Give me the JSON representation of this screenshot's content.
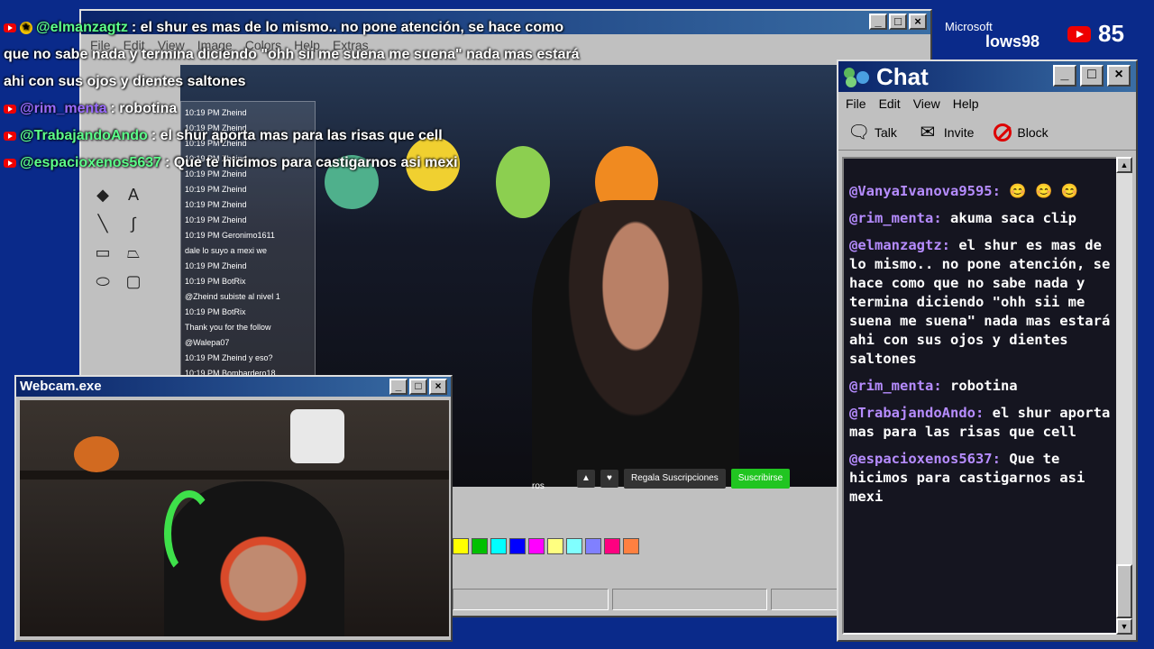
{
  "overlay_chat": {
    "lines": [
      {
        "user": "@elmanzagtz",
        "user_color": "#5cff8a",
        "text": ": el shur es mas de lo mismo.. no pone atención, se hace como"
      },
      {
        "text": "que no sabe nada y termina diciendo \"ohh sii me suena me suena\" nada mas estará"
      },
      {
        "text": "ahi con sus ojos y dientes saltones"
      },
      {
        "user": "@rim_menta",
        "user_color": "#9b6bff",
        "text": ": robotina"
      },
      {
        "user": "@TrabajandoAndo",
        "user_color": "#5cff8a",
        "text": ": el shur aporta mas para las risas que cell"
      },
      {
        "user": "@espacioxenos5637",
        "user_color": "#5cff8a",
        "text": ": Que te hicimos para castigarnos asi mexi"
      }
    ]
  },
  "top_right": {
    "microsoft": "Microsoft",
    "windows98": "lows98",
    "viewer_count": "85"
  },
  "paint": {
    "title": "",
    "menu": [
      "File",
      "Edit",
      "View",
      "Image",
      "Colors",
      "Help",
      "Extras"
    ],
    "palette": [
      "#ffff00",
      "#00c000",
      "#00ffff",
      "#0000ff",
      "#ff00ff",
      "#ffff80",
      "#80ffff",
      "#8080ff",
      "#ff0080",
      "#ff8040"
    ]
  },
  "stream": {
    "chat_lines": [
      "10:19 PM Zheind",
      "10:19 PM Zheind",
      "10:19 PM Zheind",
      "10:19 PM Zheind",
      "10:19 PM Zheind",
      "10:19 PM Zheind",
      "10:19 PM Zheind",
      "10:19 PM Zheind",
      "10:19 PM Geronimo1611",
      "dale lo suyo a mexi we",
      "10:19 PM Zheind",
      "10:19 PM BotRix",
      "@Zheind subiste al nivel 1",
      "10:19 PM BotRix",
      "Thank you for the follow",
      "@Walepa07",
      "10:19 PM Zheind y eso?",
      "10:19 PM Bombardero18"
    ],
    "regala_label": "Regala Suscripciones",
    "subscribe_label": "Suscribirse",
    "ros_text": "ros"
  },
  "chat_window": {
    "title": "Chat",
    "menu": [
      "File",
      "Edit",
      "View",
      "Help"
    ],
    "toolbar": {
      "talk": "Talk",
      "invite": "Invite",
      "block": "Block"
    },
    "messages": [
      {
        "user": "@VanyaIvanova9595:",
        "text": " ",
        "emoji": "😊 😊 😊"
      },
      {
        "user": "@rim_menta:",
        "text": " akuma saca clip"
      },
      {
        "user": "@elmanzagtz:",
        "text": " el shur es mas de lo mismo.. no pone atención, se hace como que no sabe nada y termina diciendo \"ohh sii me suena me suena\" nada mas estará ahi con sus ojos y dientes saltones"
      },
      {
        "user": "@rim_menta:",
        "text": " robotina"
      },
      {
        "user": "@TrabajandoAndo:",
        "text": " el shur aporta mas para las risas que cell"
      },
      {
        "user": "@espacioxenos5637:",
        "text": " Que te hicimos para castigarnos asi mexi"
      }
    ]
  },
  "webcam": {
    "title": "Webcam.exe"
  }
}
